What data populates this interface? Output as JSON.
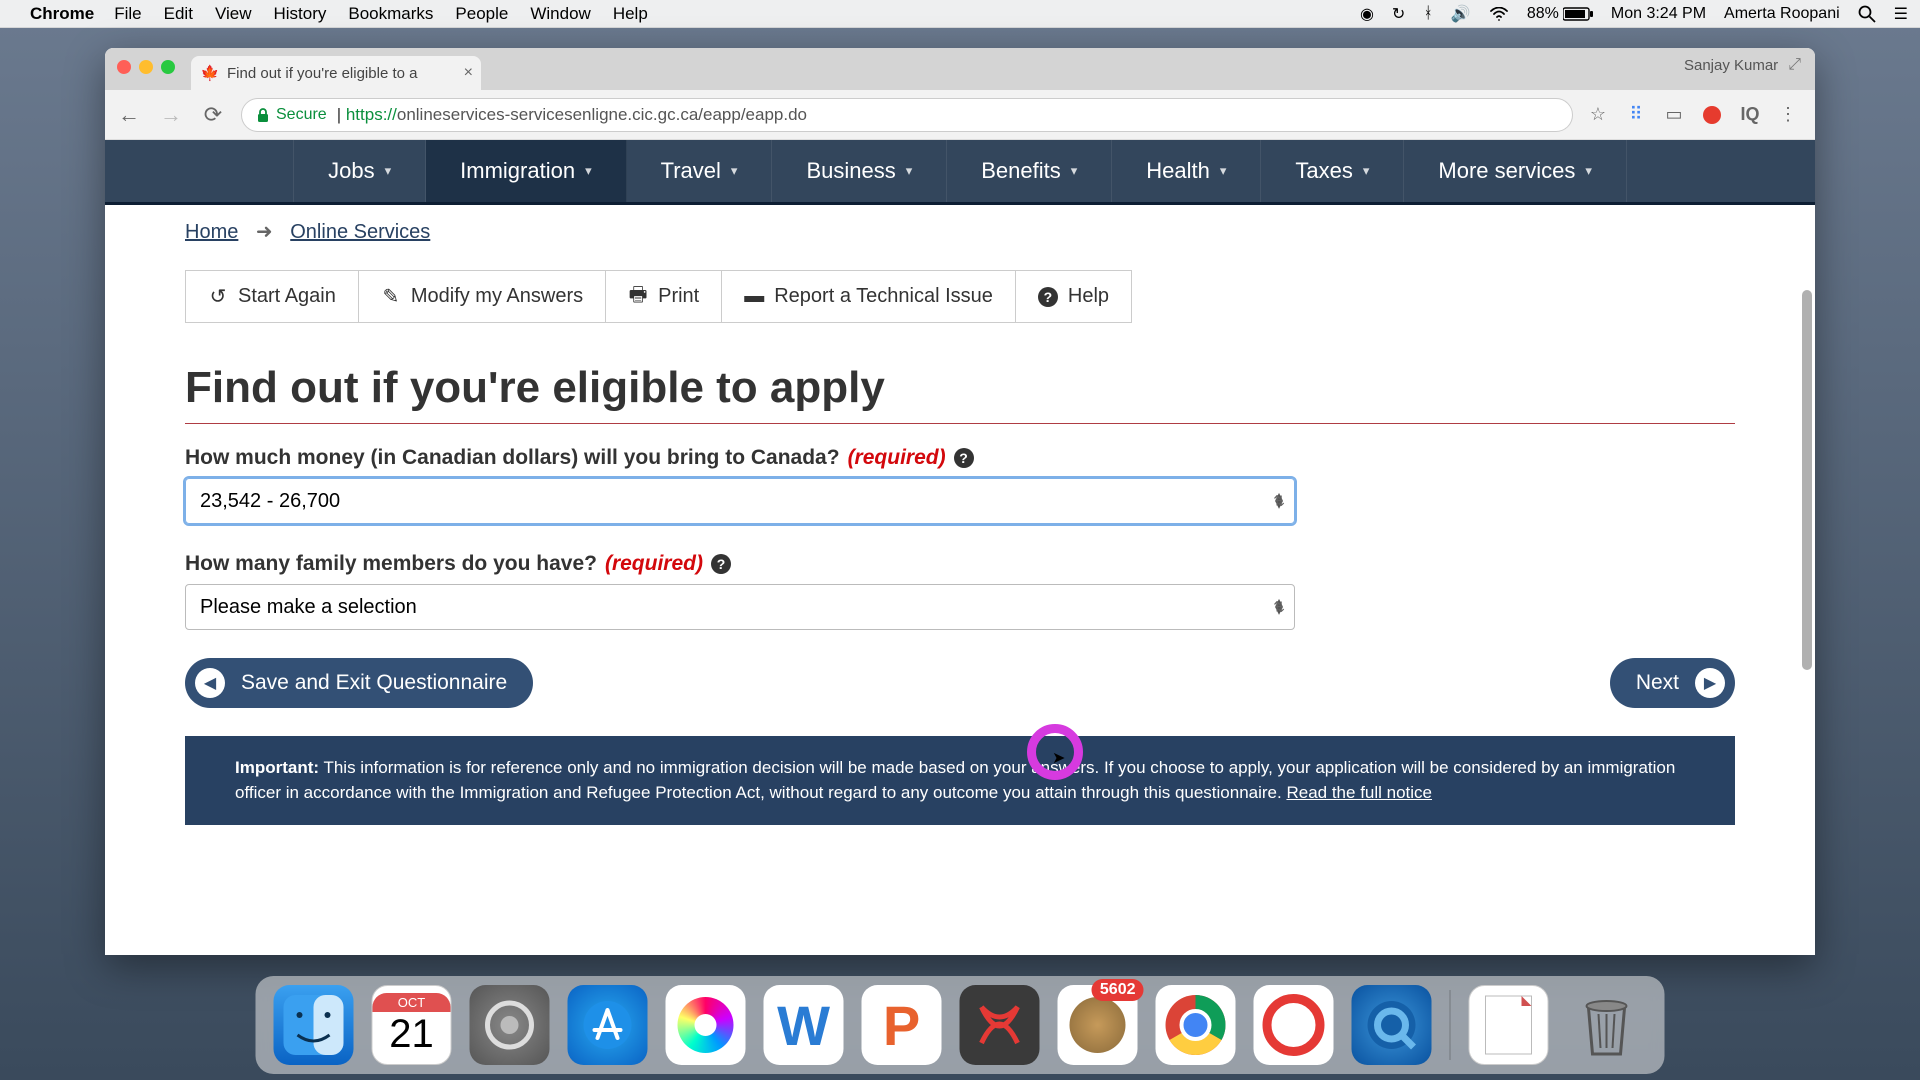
{
  "menubar": {
    "app": "Chrome",
    "items": [
      "File",
      "Edit",
      "View",
      "History",
      "Bookmarks",
      "People",
      "Window",
      "Help"
    ],
    "battery_pct": "88%",
    "clock": "Mon 3:24 PM",
    "user": "Amerta Roopani"
  },
  "browser": {
    "tab_title": "Find out if you're eligible to a",
    "profile": "Sanjay Kumar",
    "secure_label": "Secure",
    "url_proto": "https://",
    "url_rest": "onlineservices-servicesenligne.cic.gc.ca/eapp/eapp.do"
  },
  "nav": {
    "items": [
      "Jobs",
      "Immigration",
      "Travel",
      "Business",
      "Benefits",
      "Health",
      "Taxes",
      "More services"
    ],
    "active_index": 1
  },
  "breadcrumb": {
    "home": "Home",
    "current": "Online Services"
  },
  "toolbar": {
    "start_again": "Start Again",
    "modify": "Modify my Answers",
    "print": "Print",
    "report": "Report a Technical Issue",
    "help": "Help"
  },
  "page_title": "Find out if you're eligible to apply",
  "required_label": "(required)",
  "q1": {
    "label": "How much money (in Canadian dollars) will you bring to Canada?",
    "value": "23,542 - 26,700"
  },
  "q2": {
    "label": "How many family members do you have?",
    "placeholder": "Please make a selection"
  },
  "buttons": {
    "save_exit": "Save and Exit Questionnaire",
    "next": "Next"
  },
  "notice": {
    "strong": "Important:",
    "text": " This information is for reference only and no immigration decision will be made based on your answers. If you choose to apply, your application will be considered by an immigration officer in accordance with the Immigration and Refugee Protection Act, without regard to any outcome you attain through this questionnaire. ",
    "link": "Read the full notice"
  },
  "dock": {
    "cal_month": "OCT",
    "cal_day": "21",
    "mail_badge": "5602"
  }
}
